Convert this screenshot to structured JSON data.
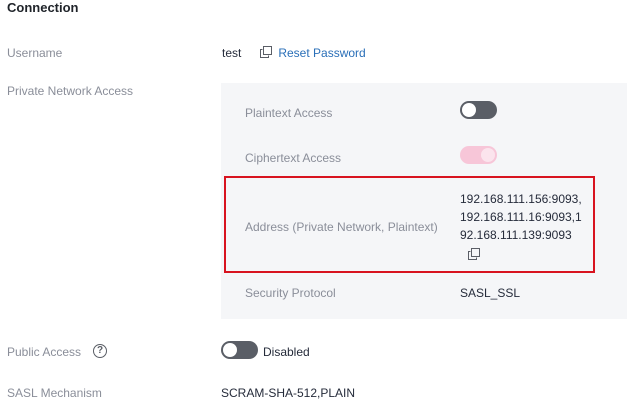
{
  "section": {
    "title": "Connection"
  },
  "username": {
    "label": "Username",
    "value": "test",
    "reset_label": "Reset Password",
    "reset_icon": "copy-icon"
  },
  "private_network": {
    "label": "Private Network Access",
    "plaintext": {
      "label": "Plaintext Access",
      "enabled": false
    },
    "ciphertext": {
      "label": "Ciphertext Access",
      "enabled": true,
      "disabled": true
    },
    "address": {
      "label": "Address (Private Network, Plaintext)",
      "lines": [
        "192.168.111.156:9093,",
        "192.168.111.16:9093,1",
        "92.168.111.139:9093"
      ],
      "copy_icon": "copy-icon"
    },
    "security_protocol": {
      "label": "Security Protocol",
      "value": "SASL_SSL"
    }
  },
  "public_access": {
    "label": "Public Access",
    "help_icon": "?",
    "enabled": false,
    "status": "Disabled"
  },
  "sasl": {
    "label": "SASL Mechanism",
    "value": "SCRAM-SHA-512,PLAIN"
  },
  "colors": {
    "link": "#2a6fb8",
    "highlight": "#d8131f",
    "toggle_off": "#5a5e66",
    "toggle_on_disabled": "#f7c6d8",
    "panel_bg": "#f5f6f8"
  }
}
